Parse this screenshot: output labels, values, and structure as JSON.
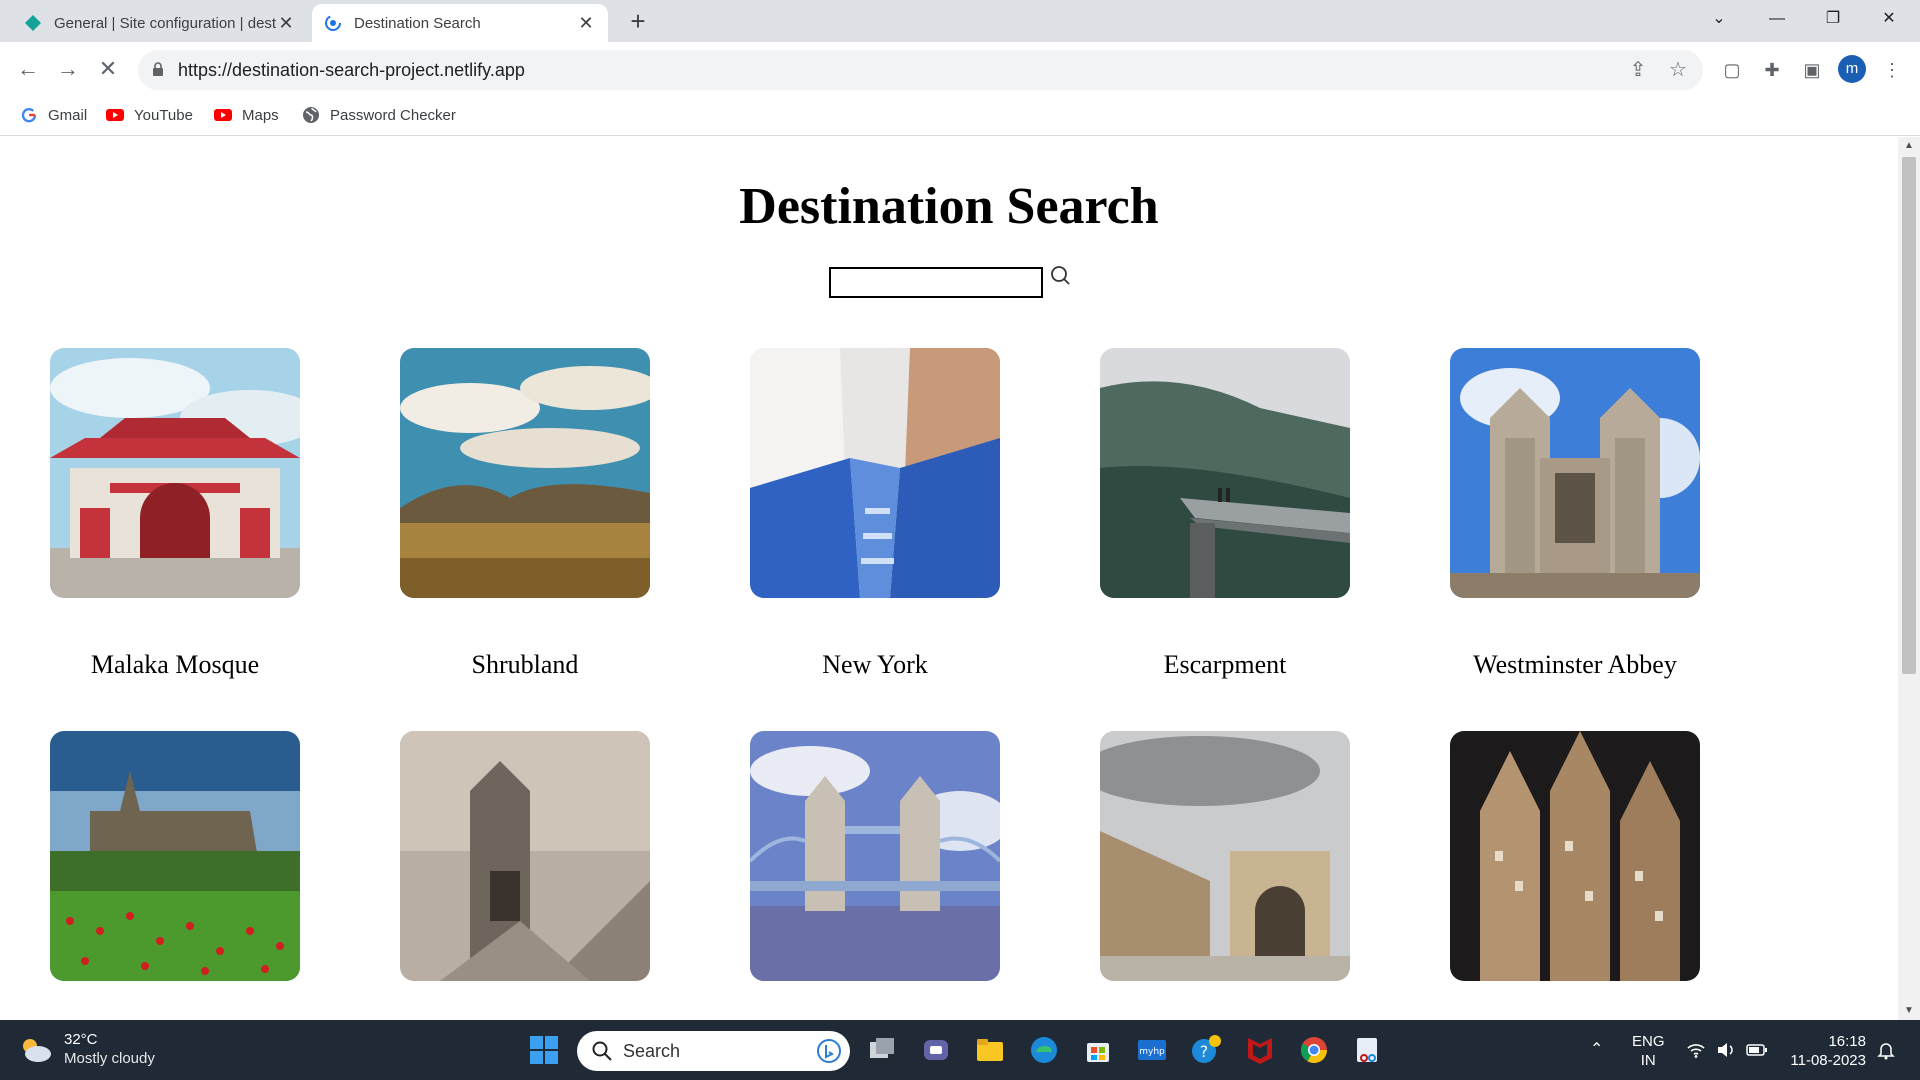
{
  "browser": {
    "tabs": [
      {
        "title": "General | Site configuration | dest",
        "active": false
      },
      {
        "title": "Destination Search",
        "active": true
      }
    ],
    "url": "https://destination-search-project.netlify.app",
    "bookmarks": [
      {
        "label": "Gmail",
        "icon": "google-icon"
      },
      {
        "label": "YouTube",
        "icon": "youtube-icon"
      },
      {
        "label": "Maps",
        "icon": "youtube-icon"
      },
      {
        "label": "Password Checker",
        "icon": "globe-icon"
      }
    ],
    "profile_initial": "m"
  },
  "page": {
    "title": "Destination Search",
    "search": {
      "value": "",
      "placeholder": ""
    },
    "destinations": [
      {
        "name": "Malaka Mosque"
      },
      {
        "name": "Shrubland"
      },
      {
        "name": "New York"
      },
      {
        "name": "Escarpment"
      },
      {
        "name": "Westminster Abbey"
      },
      {
        "name": ""
      },
      {
        "name": ""
      },
      {
        "name": ""
      },
      {
        "name": ""
      },
      {
        "name": ""
      }
    ]
  },
  "taskbar": {
    "weather": {
      "temp": "32°C",
      "condition": "Mostly cloudy"
    },
    "search_label": "Search",
    "language": {
      "line1": "ENG",
      "line2": "IN"
    },
    "clock": {
      "time": "16:18",
      "date": "11-08-2023"
    }
  }
}
